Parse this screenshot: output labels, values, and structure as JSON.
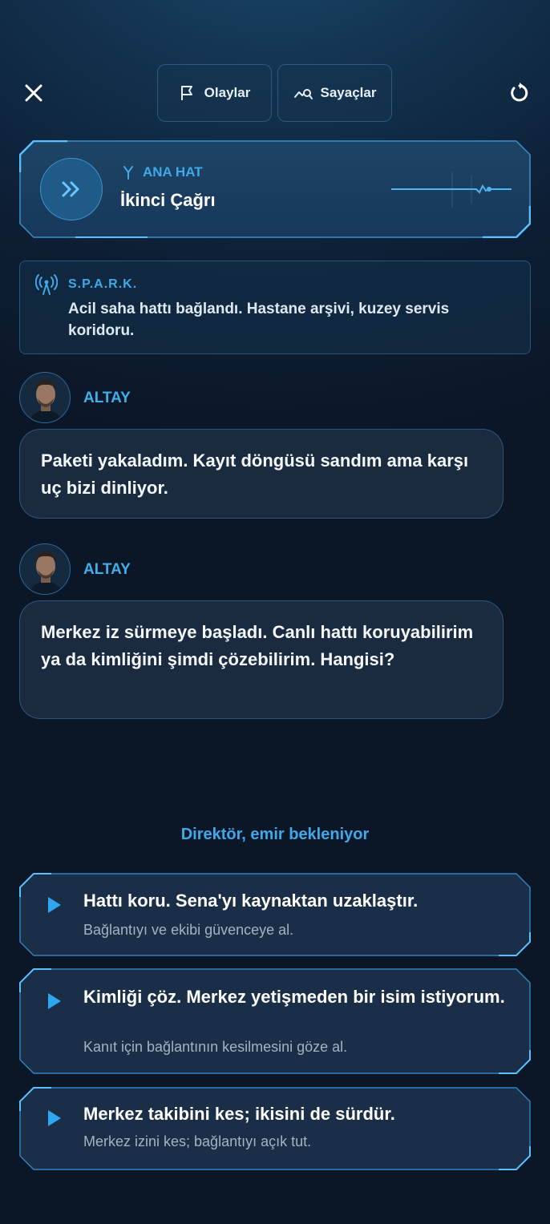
{
  "header": {
    "close_icon": "close-icon",
    "tabs": [
      {
        "label": "Olaylar",
        "icon": "flag-icon"
      },
      {
        "label": "Sayaçlar",
        "icon": "chart-search-icon"
      }
    ],
    "restart_icon": "restart-icon"
  },
  "line": {
    "tag": "ANA HAT",
    "title": "İkinci Çağrı",
    "tag_icon": "branch-icon",
    "play_icon": "double-chevron-right-icon"
  },
  "spark": {
    "name": "S.P.A.R.K.",
    "text": "Acil saha hattı bağlandı. Hastane arşivi, kuzey servis koridoru.",
    "icon": "broadcast-icon"
  },
  "messages": [
    {
      "speaker": "ALTAY",
      "text": "Paketi yakaladım. Kayıt döngüsü sandım ama karşı uç bizi dinliyor."
    },
    {
      "speaker": "ALTAY",
      "text": "Merkez iz sürmeye başladı. Canlı hattı koruyabilirim ya da kimliğini şimdi çözebilirim. Hangisi?"
    }
  ],
  "status": "Direktör, emir bekleniyor",
  "choices": [
    {
      "title": "Hattı koru. Sena'yı kaynaktan uzaklaştır.",
      "subtitle": "Bağlantıyı ve ekibi güvenceye al."
    },
    {
      "title": "Kimliği çöz. Merkez yetişmeden bir isim istiyorum.",
      "subtitle": "Kanıt için bağlantının kesilmesini göze al."
    },
    {
      "title": "Merkez takibini kes; ikisini de sürdür.",
      "subtitle": "Merkez izini kes; bağlantıyı açık tut."
    }
  ],
  "colors": {
    "accent": "#3fa9ea",
    "background": "#0b1626",
    "card": "#1a2b40"
  }
}
